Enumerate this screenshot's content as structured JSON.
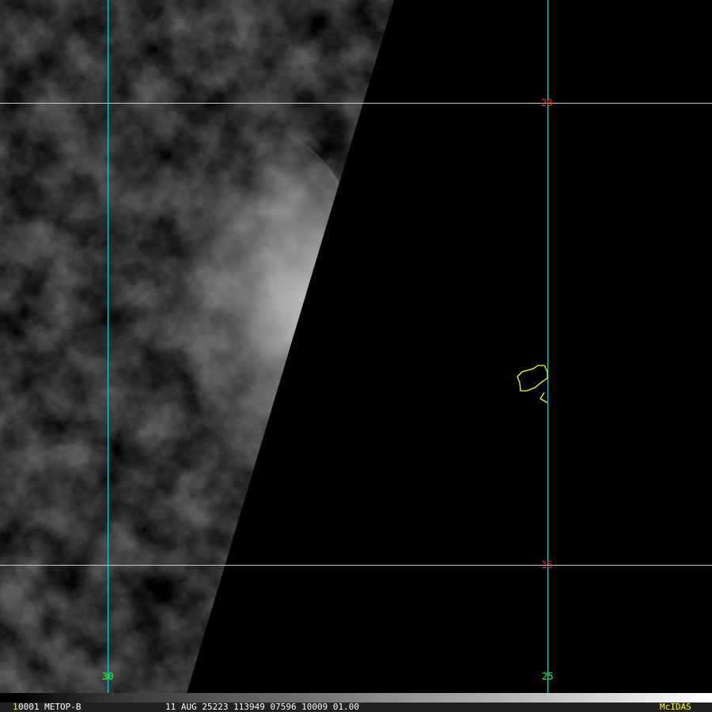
{
  "satellite_image": {
    "latitude_labels": [
      "20",
      "15"
    ],
    "longitude_labels": [
      "30",
      "25"
    ],
    "colors": {
      "grid_lat": "#c8c8c8",
      "grid_lon": "#00e0e0",
      "lat_label": "#ff2020",
      "lon_label": "#20ff20",
      "coastline": "#ffff00",
      "branding": "#ffff00"
    }
  },
  "info_bar": {
    "frame_marker": "1",
    "frame_satellite": "0001 METOP-B",
    "datetime_info": "11 AUG 25223 113949 07596 10009 01.00",
    "branding": "McIDAS"
  }
}
